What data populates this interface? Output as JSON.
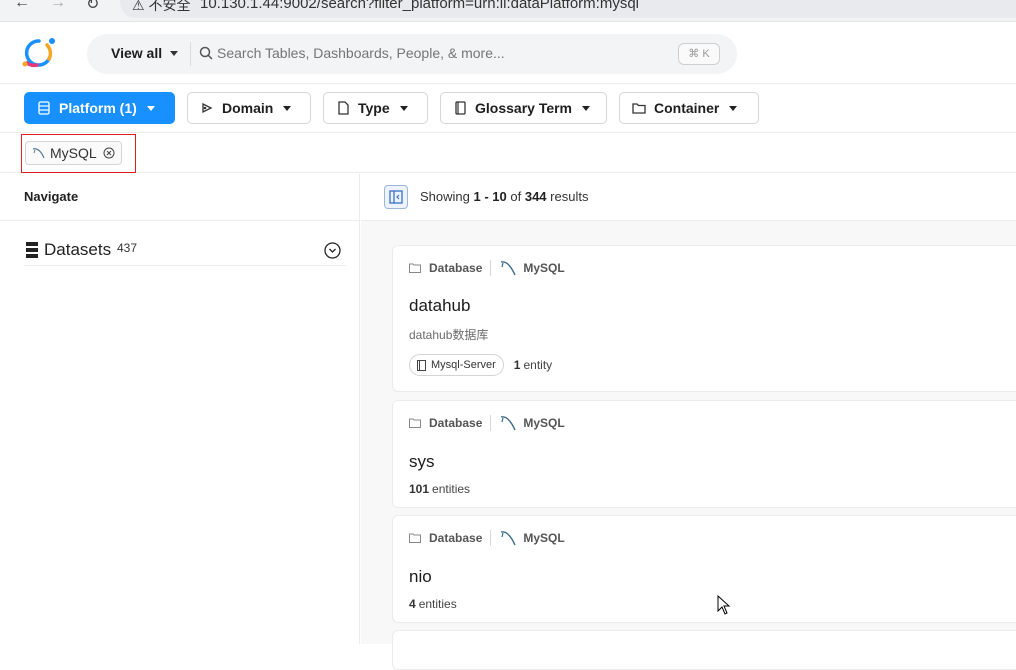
{
  "browser": {
    "security": "不安全",
    "url": "10.130.1.44:9002/search?filter_platform=urn:li:dataPlatform:mysql"
  },
  "header": {
    "view_all_label": "View all",
    "search_placeholder": "Search Tables, Dashboards, People, & more...",
    "shortcut": "⌘ K"
  },
  "filters": [
    {
      "label": "Platform (1)",
      "icon": "database-icon",
      "active": true
    },
    {
      "label": "Domain",
      "icon": "domain-icon",
      "active": false
    },
    {
      "label": "Type",
      "icon": "file-icon",
      "active": false
    },
    {
      "label": "Glossary Term",
      "icon": "book-icon",
      "active": false
    },
    {
      "label": "Container",
      "icon": "folder-icon",
      "active": false
    }
  ],
  "active_filter_chip": {
    "label": "MySQL"
  },
  "left_nav": {
    "heading": "Navigate",
    "dataset_label": "Datasets",
    "dataset_count": "437"
  },
  "results": {
    "showing_prefix": "Showing",
    "range": "1 - 10",
    "of_word": "of",
    "total": "344",
    "suffix": "results"
  },
  "cards": [
    {
      "type_label": "Database",
      "platform": "MySQL",
      "title": "datahub",
      "description": "datahub数据库",
      "tag": "Mysql-Server",
      "count": "1",
      "count_label": "entity"
    },
    {
      "type_label": "Database",
      "platform": "MySQL",
      "title": "sys",
      "count": "101",
      "count_label": "entities"
    },
    {
      "type_label": "Database",
      "platform": "MySQL",
      "title": "nio",
      "count": "4",
      "count_label": "entities"
    }
  ],
  "colors": {
    "accent": "#1890ff",
    "highlight_border": "#e02020"
  }
}
